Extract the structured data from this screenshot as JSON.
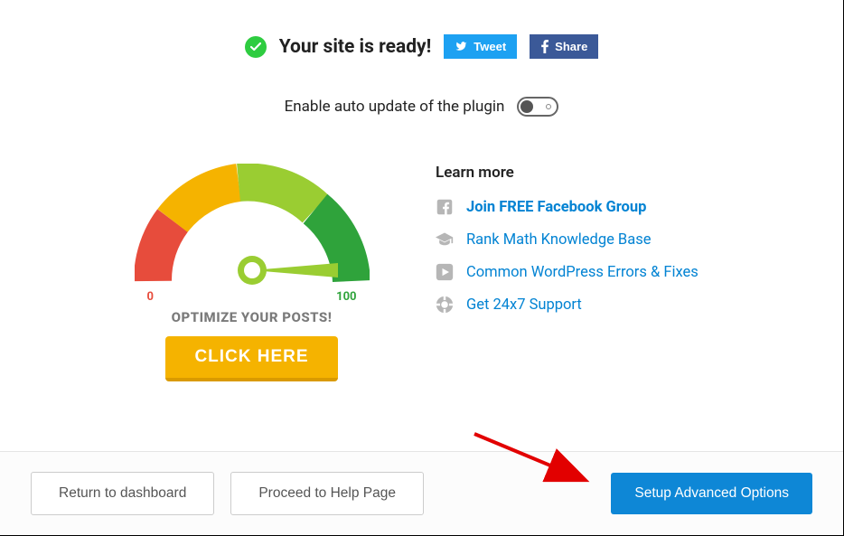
{
  "header": {
    "ready_text": "Your site is ready!",
    "tweet_label": "Tweet",
    "share_label": "Share"
  },
  "auto_update": {
    "label": "Enable auto update of the plugin",
    "enabled": false
  },
  "gauge": {
    "min_label": "0",
    "max_label": "100",
    "caption": "OPTIMIZE YOUR POSTS!",
    "cta": "CLICK HERE"
  },
  "learn_more": {
    "heading": "Learn more",
    "items": [
      {
        "label": "Join FREE Facebook Group",
        "icon": "facebook-icon",
        "bold": true
      },
      {
        "label": "Rank Math Knowledge Base",
        "icon": "graduation-cap-icon",
        "bold": false
      },
      {
        "label": "Common WordPress Errors & Fixes",
        "icon": "play-icon",
        "bold": false
      },
      {
        "label": "Get 24x7 Support",
        "icon": "globe-icon",
        "bold": false
      }
    ]
  },
  "footer": {
    "dashboard": "Return to dashboard",
    "help": "Proceed to Help Page",
    "advanced": "Setup Advanced Options"
  }
}
